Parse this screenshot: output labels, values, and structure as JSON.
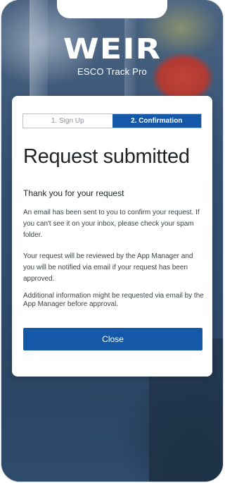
{
  "brand": {
    "logo_text": "WEIR",
    "app_name": "ESCO Track Pro"
  },
  "steps": [
    {
      "label": "1. Sign Up",
      "active": false
    },
    {
      "label": "2. Confirmation",
      "active": true
    }
  ],
  "content": {
    "title": "Request submitted",
    "subtitle": "Thank you for your request",
    "paragraphs": [
      "An email has been sent to you to confirm your request. If you can't see it on your inbox, please check your spam folder.",
      "Your request will be reviewed by the App Manager and you will be notified via email if your request has been approved.",
      "Additional information might be requested via email by the App Manager before approval."
    ]
  },
  "actions": {
    "close_label": "Close"
  },
  "colors": {
    "primary": "#1558a8",
    "card_background": "#ffffff",
    "text_dark": "#1f2328"
  }
}
